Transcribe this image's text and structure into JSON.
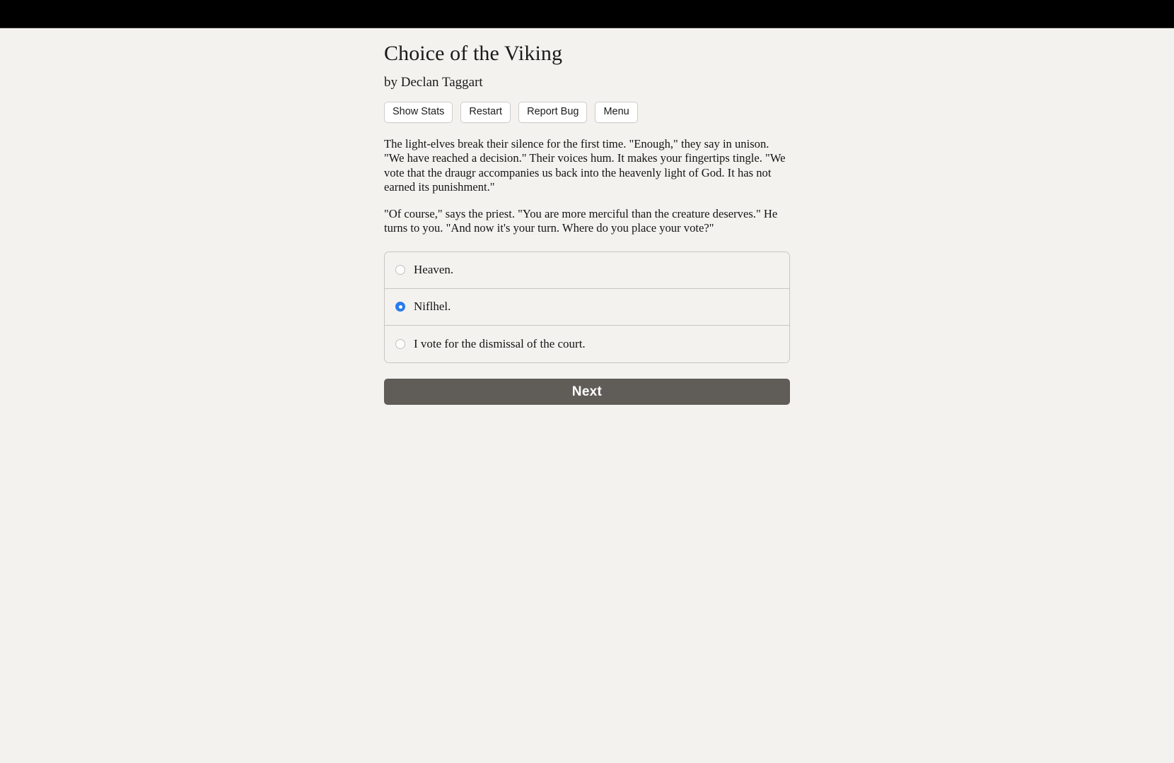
{
  "window": {
    "chrome_bar_color": "#000000"
  },
  "page": {
    "background_color": "#f4f2ee",
    "title": "Choice of the Viking",
    "byline": "by Declan Taggart"
  },
  "toolbar": {
    "buttons": [
      {
        "label": "Show Stats",
        "name": "show-stats-button"
      },
      {
        "label": "Restart",
        "name": "restart-button"
      },
      {
        "label": "Report Bug",
        "name": "report-bug-button"
      },
      {
        "label": "Menu",
        "name": "menu-button"
      }
    ]
  },
  "story": {
    "paragraphs": [
      "The light-elves break their silence for the first time. \"Enough,\" they say in unison. \"We have reached a decision.\" Their voices hum. It makes your fingertips tingle. \"We vote that the draugr accompanies us back into the heavenly light of God. It has not earned its punishment.\"",
      "\"Of course,\" says the priest. \"You are more merciful than the creature deserves.\" He turns to you. \"And now it's your turn. Where do you place your vote?\""
    ]
  },
  "choices": {
    "selected_index": 1,
    "options": [
      {
        "label": "Heaven.",
        "selected": false
      },
      {
        "label": "Niflhel.",
        "selected": true
      },
      {
        "label": "I vote for the dismissal of the court.",
        "selected": false
      }
    ]
  },
  "actions": {
    "next_label": "Next",
    "next_background_color": "#605d59",
    "radio_selected_color": "#2a7bf0"
  }
}
